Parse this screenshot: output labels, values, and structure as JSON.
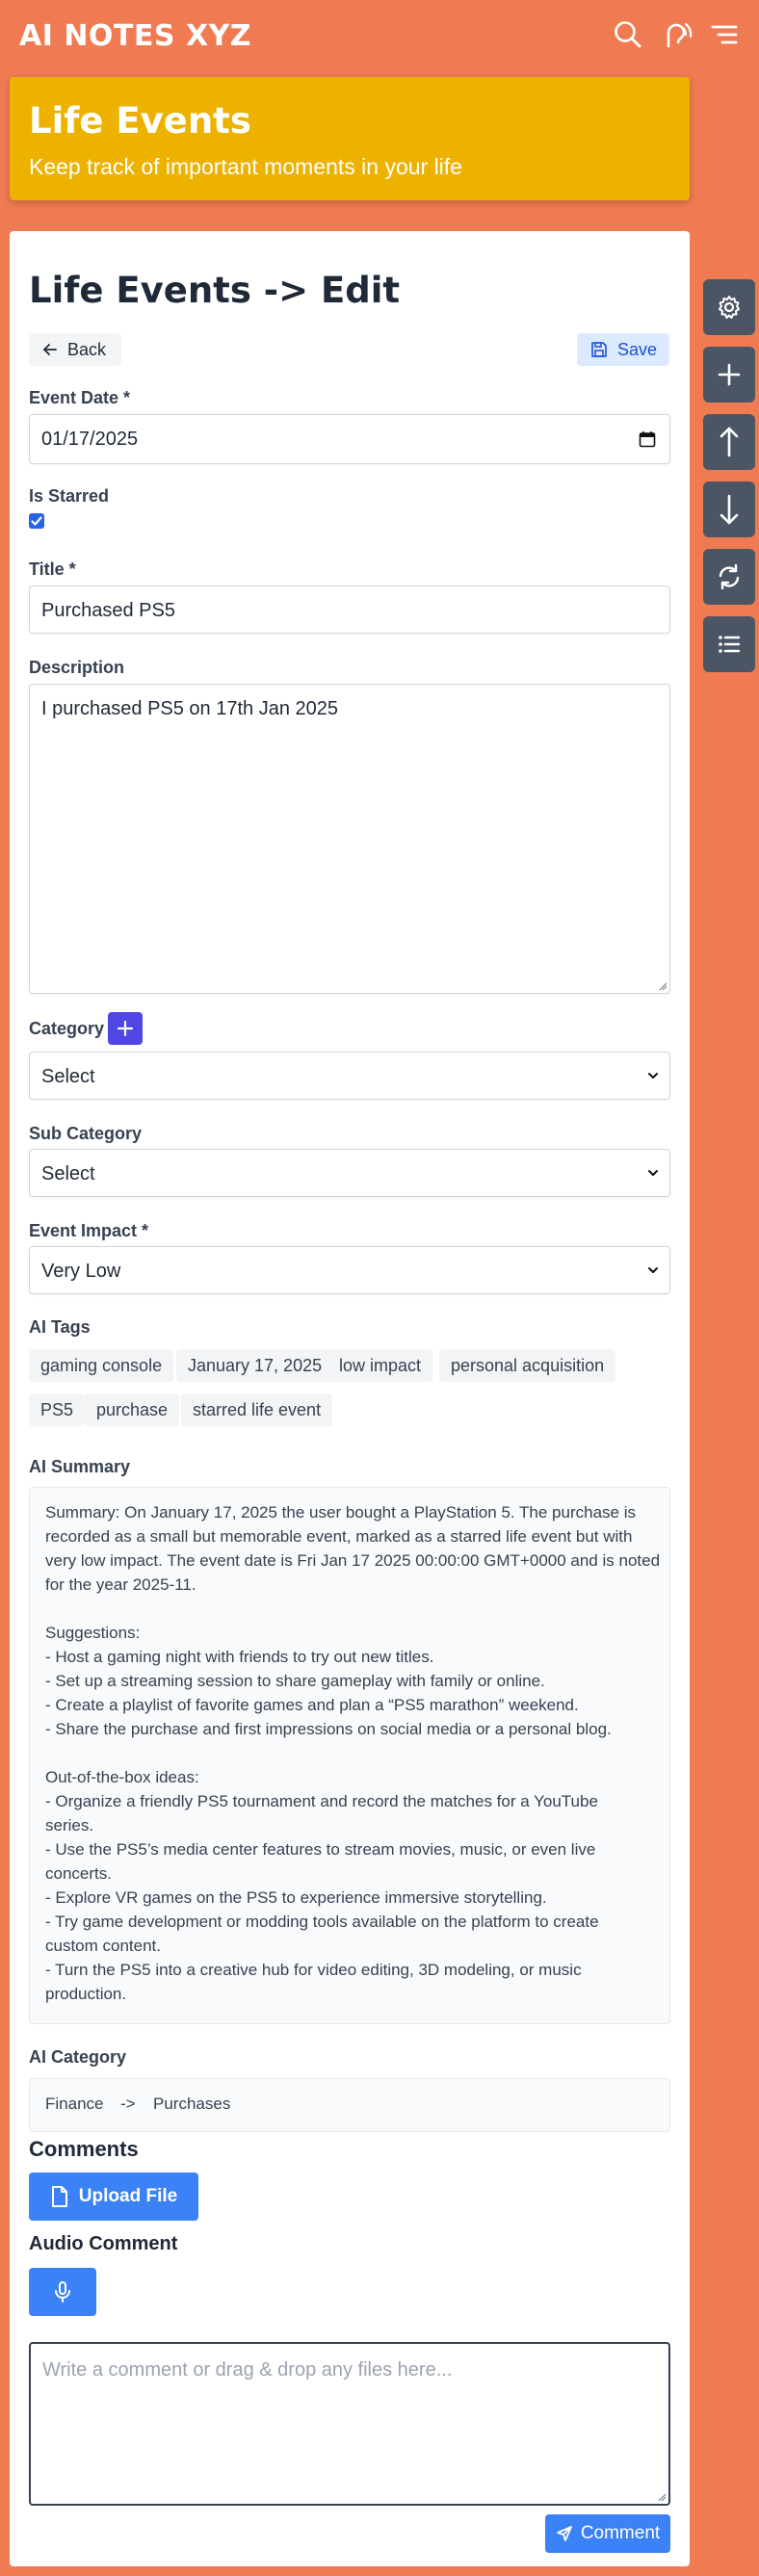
{
  "app": {
    "title": "AI NOTES XYZ"
  },
  "header_icons": [
    "search-icon",
    "voice-icon",
    "menu-icon"
  ],
  "banner": {
    "title": "Life Events",
    "subtitle": "Keep track of important moments in your life"
  },
  "page": {
    "title": "Life Events -> Edit"
  },
  "toolbar": {
    "back_label": "Back",
    "save_label": "Save"
  },
  "side_buttons": [
    "settings-icon",
    "plus-icon",
    "arrow-up-icon",
    "arrow-down-icon",
    "refresh-icon",
    "list-icon"
  ],
  "form": {
    "event_date": {
      "label": "Event Date *",
      "value": "01/17/2025"
    },
    "is_starred": {
      "label": "Is Starred",
      "checked": true
    },
    "title": {
      "label": "Title *",
      "value": "Purchased PS5"
    },
    "description": {
      "label": "Description",
      "value": "I purchased PS5 on 17th Jan 2025"
    },
    "category": {
      "label": "Category",
      "value": "Select"
    },
    "sub_category": {
      "label": "Sub Category",
      "value": "Select"
    },
    "event_impact": {
      "label": "Event Impact *",
      "value": "Very Low"
    }
  },
  "ai_tags": {
    "label": "AI Tags",
    "tags": [
      "gaming console",
      "January 17, 2025",
      "low impact",
      "personal acquisition",
      "PS5",
      "purchase",
      "starred life event"
    ]
  },
  "ai_summary": {
    "label": "AI Summary",
    "lines": [
      "Summary: On January 17, 2025 the user bought a PlayStation 5. The purchase is",
      "recorded as a small but memorable event, marked as a starred life event but with",
      "very low impact. The event date is Fri Jan 17 2025 00:00:00 GMT+0000 and is noted",
      "for the year 2025-11.",
      "",
      "Suggestions:",
      "- Host a gaming night with friends to try out new titles.",
      "- Set up a streaming session to share gameplay with family or online.",
      "- Create a playlist of favorite games and plan a “PS5 marathon” weekend.",
      "- Share the purchase and first impressions on social media or a personal blog.",
      "",
      "Out-of-the-box ideas:",
      "- Organize a friendly PS5 tournament and record the matches for a YouTube",
      "series.",
      "- Use the PS5’s media center features to stream movies, music, or even live",
      "concerts.",
      "- Explore VR games on the PS5 to experience immersive storytelling.",
      "- Try game development or modding tools available on the platform to create",
      "custom content.",
      "- Turn the PS5 into a creative hub for video editing, 3D modeling, or music",
      "production."
    ]
  },
  "ai_category": {
    "label": "AI Category",
    "category": "Finance",
    "separator": "->",
    "sub_category": "Purchases"
  },
  "comments": {
    "heading": "Comments",
    "upload_label": "Upload File",
    "audio_heading": "Audio Comment",
    "placeholder": "Write a comment or drag & drop any files here...",
    "submit_label": "Comment"
  },
  "colors": {
    "background": "#F07B52",
    "banner": "#EDB100",
    "primary": "#3b82f6",
    "accent": "#4f46e5",
    "side_button": "#4b5563"
  }
}
